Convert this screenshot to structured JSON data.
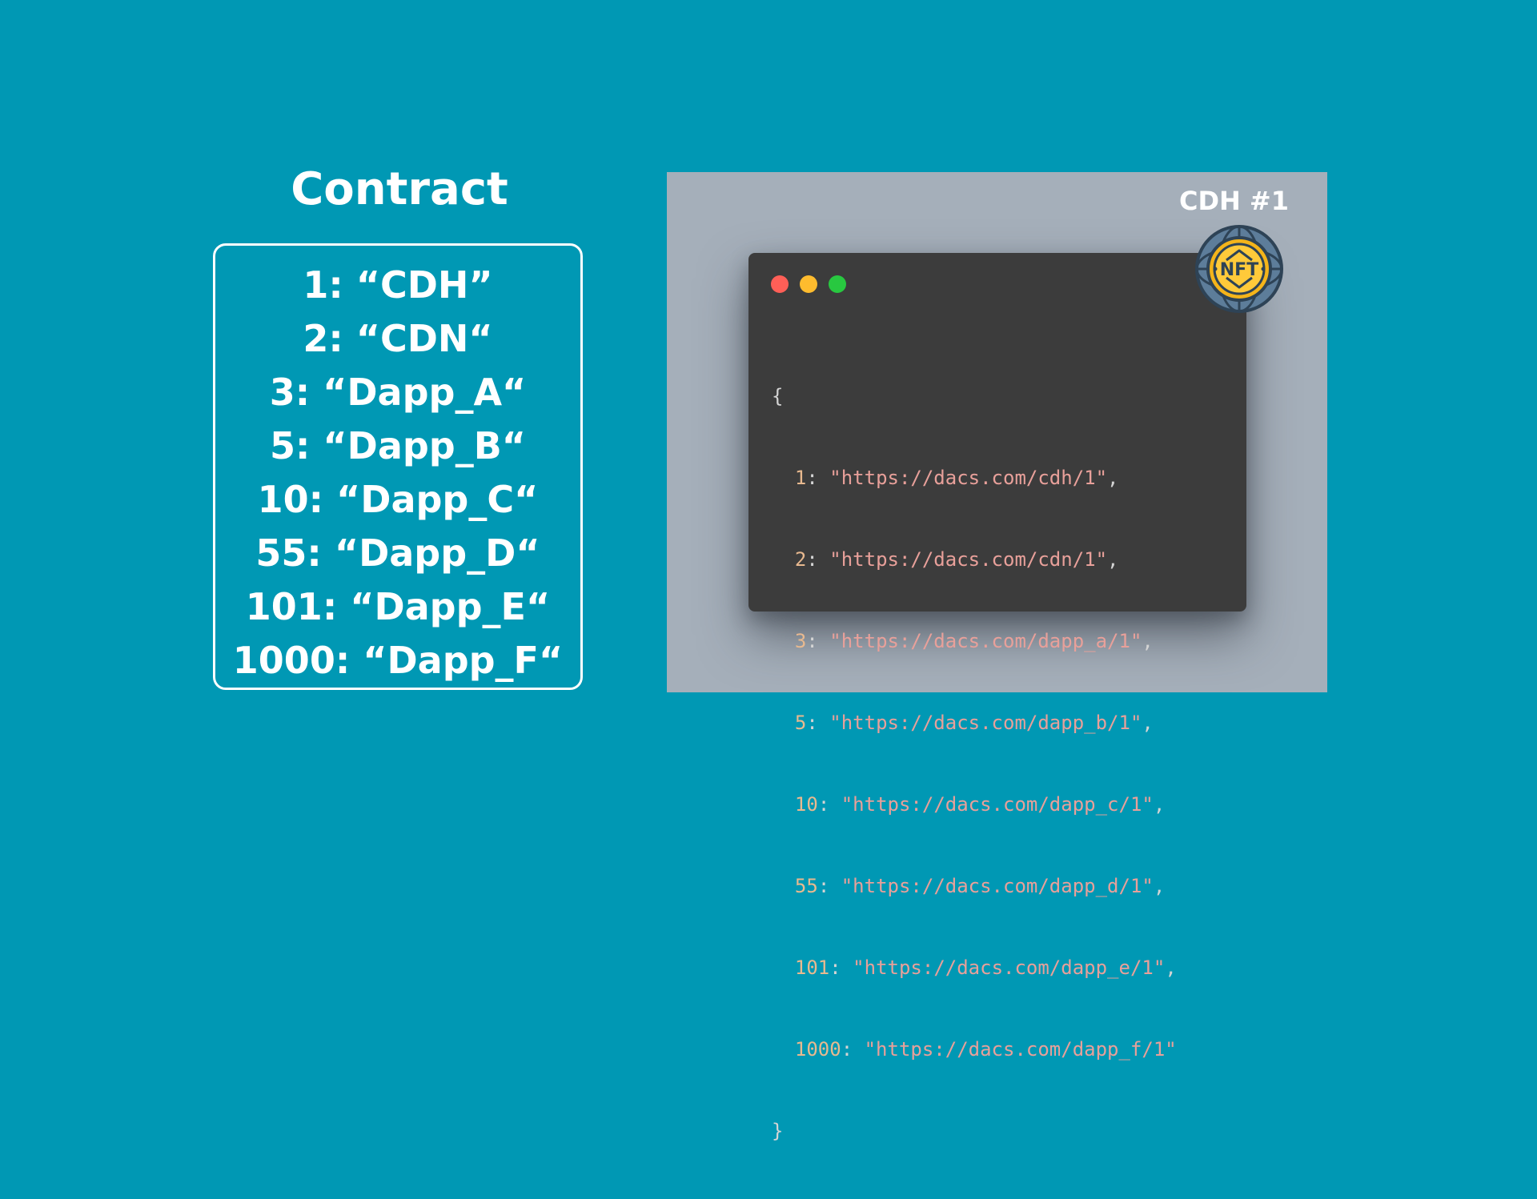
{
  "contract": {
    "title": "Contract",
    "entries": [
      "1: “CDH”",
      "2: “CDN“",
      "3: “Dapp_A“",
      "5: “Dapp_B“",
      "10: “Dapp_C“",
      "55: “Dapp_D“",
      "101: “Dapp_E“",
      "1000: “Dapp_F“"
    ]
  },
  "nft": {
    "title": "CDH #1",
    "badge_text": "NFT",
    "badge_icon": "nft-globe-icon",
    "window_dot_colors": [
      "#ff5f57",
      "#febc2e",
      "#28c840"
    ],
    "code": {
      "open": "{",
      "close": "}",
      "lines": [
        {
          "key": "1",
          "value": "\"https://dacs.com/cdh/1\"",
          "trail": ","
        },
        {
          "key": "2",
          "value": "\"https://dacs.com/cdn/1\"",
          "trail": ","
        },
        {
          "key": "3",
          "value": "\"https://dacs.com/dapp_a/1\"",
          "trail": ","
        },
        {
          "key": "5",
          "value": "\"https://dacs.com/dapp_b/1\"",
          "trail": ","
        },
        {
          "key": "10",
          "value": "\"https://dacs.com/dapp_c/1\"",
          "trail": ","
        },
        {
          "key": "55",
          "value": "\"https://dacs.com/dapp_d/1\"",
          "trail": ","
        },
        {
          "key": "101",
          "value": "\"https://dacs.com/dapp_e/1\"",
          "trail": ","
        },
        {
          "key": "1000",
          "value": "\"https://dacs.com/dapp_f/1\"",
          "trail": ""
        }
      ]
    }
  },
  "colors": {
    "background": "#0098b4",
    "panel": "#a5afba",
    "code_window": "#3c3c3c",
    "code_key": "#e8b98f",
    "code_string": "#e8a09a",
    "badge_gold": "#f4b41a",
    "badge_globe": "#5d7d9a"
  }
}
